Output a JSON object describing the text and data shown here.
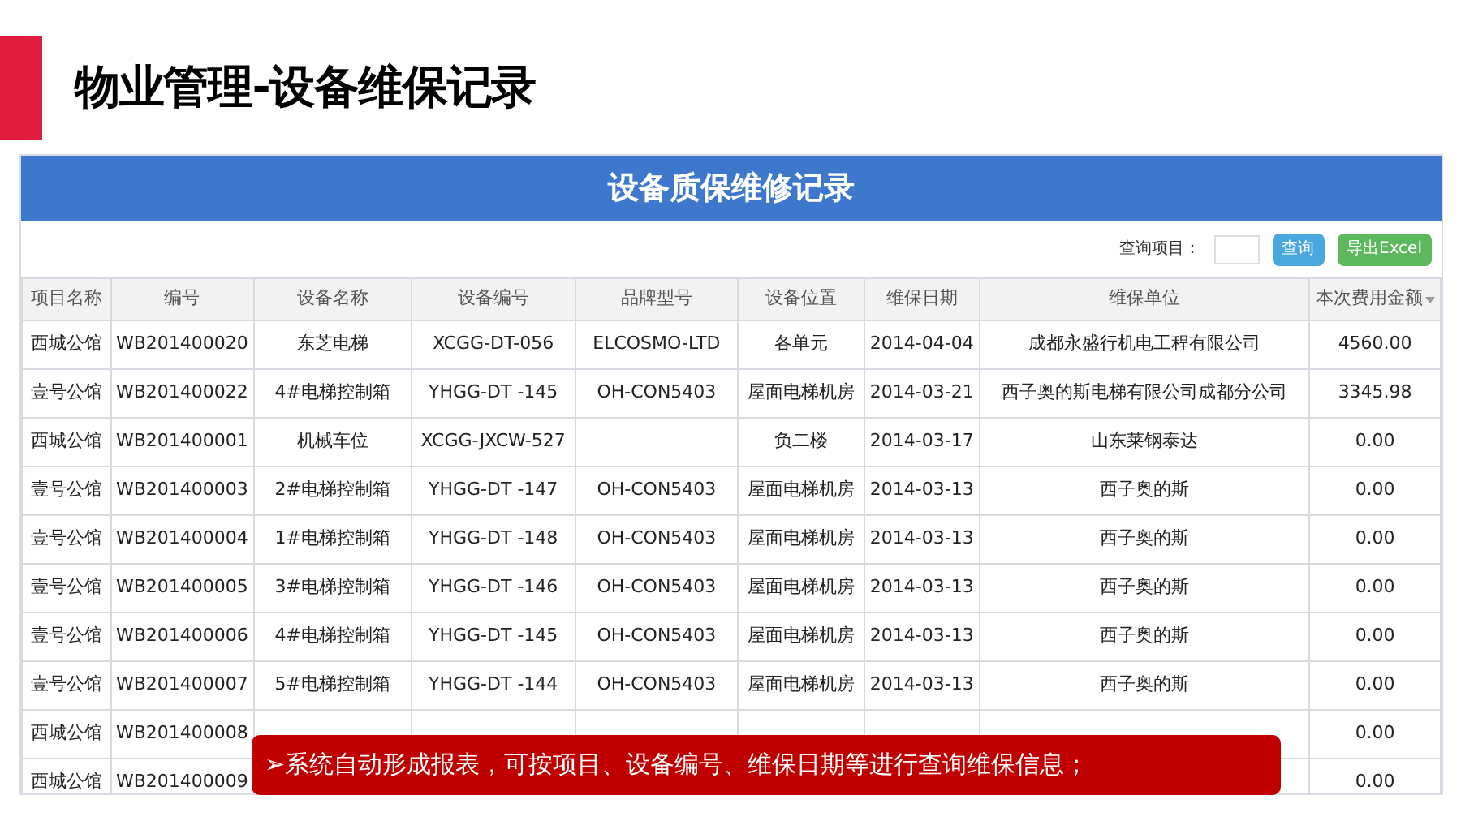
{
  "page_title": "物业管理-设备维保记录",
  "panel": {
    "title": "设备质保维修记录",
    "toolbar": {
      "search_label": "查询项目：",
      "search_button": "查询",
      "export_button": "导出Excel"
    },
    "table": {
      "columns": [
        {
          "label": "项目名称",
          "sorted": false
        },
        {
          "label": "编号",
          "sorted": false
        },
        {
          "label": "设备名称",
          "sorted": false
        },
        {
          "label": "设备编号",
          "sorted": false
        },
        {
          "label": "品牌型号",
          "sorted": false
        },
        {
          "label": "设备位置",
          "sorted": false
        },
        {
          "label": "维保日期",
          "sorted": false
        },
        {
          "label": "维保单位",
          "sorted": false
        },
        {
          "label": "本次费用金额",
          "sorted": true
        }
      ],
      "rows": [
        {
          "project": "西城公馆",
          "code": "WB201400020",
          "device_name": "东芝电梯",
          "device_code": "XCGG-DT-056",
          "brand_model": "ELCOSMO-LTD",
          "location": "各单元",
          "date": "2014-04-04",
          "vendor": "成都永盛行机电工程有限公司",
          "amount": "4560.00"
        },
        {
          "project": "壹号公馆",
          "code": "WB201400022",
          "device_name": "4#电梯控制箱",
          "device_code": "YHGG-DT -145",
          "brand_model": "OH-CON5403",
          "location": "屋面电梯机房",
          "date": "2014-03-21",
          "vendor": "西子奥的斯电梯有限公司成都分公司",
          "amount": "3345.98"
        },
        {
          "project": "西城公馆",
          "code": "WB201400001",
          "device_name": "机械车位",
          "device_code": "XCGG-JXCW-527",
          "location": "负二楼",
          "date": "2014-03-17",
          "vendor": "山东莱钢泰达",
          "amount": "0.00"
        },
        {
          "project": "壹号公馆",
          "code": "WB201400003",
          "device_name": "2#电梯控制箱",
          "device_code": "YHGG-DT -147",
          "brand_model": "OH-CON5403",
          "location": "屋面电梯机房",
          "date": "2014-03-13",
          "vendor": "西子奥的斯",
          "amount": "0.00"
        },
        {
          "project": "壹号公馆",
          "code": "WB201400004",
          "device_name": "1#电梯控制箱",
          "device_code": "YHGG-DT -148",
          "brand_model": "OH-CON5403",
          "location": "屋面电梯机房",
          "date": "2014-03-13",
          "vendor": "西子奥的斯",
          "amount": "0.00"
        },
        {
          "project": "壹号公馆",
          "code": "WB201400005",
          "device_name": "3#电梯控制箱",
          "device_code": "YHGG-DT -146",
          "brand_model": "OH-CON5403",
          "location": "屋面电梯机房",
          "date": "2014-03-13",
          "vendor": "西子奥的斯",
          "amount": "0.00"
        },
        {
          "project": "壹号公馆",
          "code": "WB201400006",
          "device_name": "4#电梯控制箱",
          "device_code": "YHGG-DT -145",
          "brand_model": "OH-CON5403",
          "location": "屋面电梯机房",
          "date": "2014-03-13",
          "vendor": "西子奥的斯",
          "amount": "0.00"
        },
        {
          "project": "壹号公馆",
          "code": "WB201400007",
          "device_name": "5#电梯控制箱",
          "device_code": "YHGG-DT -144",
          "brand_model": "OH-CON5403",
          "location": "屋面电梯机房",
          "date": "2014-03-13",
          "vendor": "西子奥的斯",
          "amount": "0.00"
        },
        {
          "project": "西城公馆",
          "code": "WB201400008",
          "amount": "0.00"
        },
        {
          "project": "西城公馆",
          "code": "WB201400009",
          "amount": "0.00"
        }
      ]
    }
  },
  "callout": {
    "marker": "➢",
    "text": "系统自动形成报表，可按项目、设备编号、维保日期等进行查询维保信息；"
  }
}
